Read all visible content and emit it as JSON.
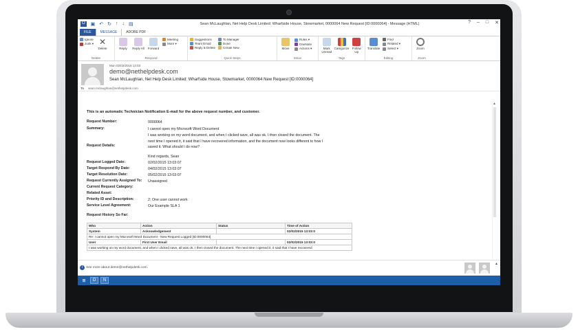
{
  "window": {
    "title": "Sean McLaughlan, Net Help Desk Limited: Wharfside House, Stowmarket, 0000064 New Request [ID:0000064] - Message (HTML)",
    "controls": [
      "?",
      "–",
      "□",
      "✕"
    ]
  },
  "tabs": [
    {
      "label": "FILE"
    },
    {
      "label": "MESSAGE"
    },
    {
      "label": "ADOBE PDF"
    }
  ],
  "ribbon": {
    "delete": {
      "ignore": "Ignore",
      "junk": "Junk ▾",
      "delete": "Delete",
      "label": "Delete"
    },
    "respond": {
      "reply": "Reply",
      "reply_all": "Reply All",
      "forward": "Forward",
      "meeting": "Meeting",
      "more": "More ▾",
      "label": "Respond"
    },
    "quick_steps": {
      "items": [
        "Suggestions",
        "Team Email",
        "Reply & Delete",
        "To Manager",
        "Done",
        "Create New"
      ],
      "label": "Quick Steps"
    },
    "move": {
      "move": "Move",
      "rules": "Rules ▾",
      "onenote": "OneNote",
      "actions": "Actions ▾",
      "label": "Move"
    },
    "tags": {
      "mark_unread": "Mark Unread",
      "categorize": "Categorize",
      "follow_up": "Follow Up",
      "label": "Tags"
    },
    "editing": {
      "translate": "Translate",
      "find": "Find",
      "related": "Related ▾",
      "select": "Select ▾",
      "label": "Editing"
    },
    "zoom": {
      "zoom": "Zoom",
      "label": "Zoom"
    }
  },
  "message": {
    "date": "Mon 02/02/2015 13:03",
    "from": "demo@nethelpdesk.com",
    "subject": "Sean McLaughlan, Net Help Desk Limited: Wharfside House, Stowmarket, 0000064 New Request [ID:0000064]",
    "to_label": "To",
    "to": "sean.mclaughlan@nethelpdesk.com"
  },
  "body": {
    "intro": "This is an automatic Technician Notification E-mail for the above request number, and customer.",
    "fields": [
      {
        "k": "Request Number:",
        "v": "0000064"
      },
      {
        "k": "Summary:",
        "v": "I cannot open my Microsoft Word Document"
      },
      {
        "k": "Request Details:",
        "v": "I was working on my word document, and when I clicked save, all was ok. I then closed the document. The next time I opened it, it said that I have recovered information, and the document now looks different to how I saved it. What should I do now?"
      },
      {
        "k": "",
        "v": "Kind regards, Sean"
      },
      {
        "k": "Request Logged Date:",
        "v": "02/02/2015 13:03:07"
      },
      {
        "k": "Target Respond By Date:",
        "v": "04/02/2015 13:03:07"
      },
      {
        "k": "Target Resolution Date:",
        "v": "05/02/2015 13:03:07"
      },
      {
        "k": "Request Currently Assigned To:",
        "v": "Unassigned"
      },
      {
        "k": "Current Request Category:",
        "v": ""
      },
      {
        "k": "Related Asset:",
        "v": ""
      },
      {
        "k": "Priority ID and Description:",
        "v": "2: One user cannot work"
      },
      {
        "k": "Service Level Agreement:",
        "v": "Our Example SLA 1"
      }
    ],
    "history_title": "Request History So Far:",
    "history_headers": [
      "Who",
      "Action",
      "Status",
      "Time of Action"
    ],
    "history_rows": [
      [
        "System",
        "Acknowledgement",
        "",
        "02/02/2015 13:03:0"
      ],
      [
        "Re: I cannot open my Microsoft Word Document - New Request Logged [ID:0000064]",
        "",
        "",
        ""
      ],
      [
        "User",
        "First User Email",
        "",
        "02/02/2015 13:03:0"
      ],
      [
        "I was working on my word document, and when I clicked save, all was ok. I then closed the document. The next time I opened it, it said that I have recovered",
        "",
        "",
        ""
      ]
    ]
  },
  "people_pane": {
    "text": "See more about demo@nethelpdesk.com."
  },
  "taskbar": {
    "items": [
      "windows-icon",
      "outlook-icon",
      "onenote-icon"
    ]
  }
}
